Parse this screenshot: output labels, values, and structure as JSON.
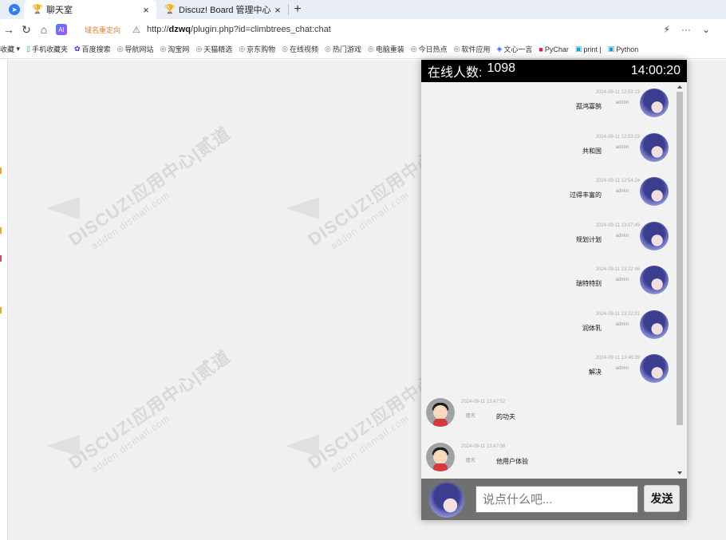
{
  "browser": {
    "tabs": [
      {
        "label": "聊天室",
        "active": true
      },
      {
        "label": "Discuz! Board 管理中心",
        "active": false
      }
    ],
    "redirect_label": "域名重定向",
    "url_prefix": "http://",
    "url_host": "dzwq",
    "url_path": "/plugin.php?id=climbtrees_chat:chat",
    "bookmarks": [
      "收藏",
      "手机收藏夹",
      "百度搜索",
      "导航网站",
      "淘宝网",
      "天猫精选",
      "京东购物",
      "在线视频",
      "热门游戏",
      "电脑重装",
      "今日热点",
      "软件应用",
      "文心一言",
      "PyChar",
      "print |",
      "Python"
    ]
  },
  "chat": {
    "online_label": "在线人数:",
    "online_count": "1098",
    "clock": "14:00:20",
    "messages": [
      {
        "side": "mine",
        "time": "2024-09-11 12:53:13",
        "user": "admin",
        "text": "孤鸿寡鹄"
      },
      {
        "side": "mine",
        "time": "2024-09-11 12:53:23",
        "user": "admin",
        "text": "共和国"
      },
      {
        "side": "mine",
        "time": "2024-09-11 12:54:24",
        "user": "admin",
        "text": "过得丰富的"
      },
      {
        "side": "mine",
        "time": "2024-09-11 13:07:49",
        "user": "admin",
        "text": "规划计划"
      },
      {
        "side": "mine",
        "time": "2024-09-11 13:22:46",
        "user": "admin",
        "text": "瑞特特别"
      },
      {
        "side": "mine",
        "time": "2024-09-11 13:22:51",
        "user": "admin",
        "text": "润体乳"
      },
      {
        "side": "mine",
        "time": "2024-09-11 13:46:39",
        "user": "admin",
        "text": "解决"
      },
      {
        "side": "other",
        "time": "2024-09-11 13:47:52",
        "user": "匿名",
        "text": "的功夫"
      },
      {
        "side": "other",
        "time": "2024-09-11 13:47:56",
        "user": "匿名",
        "text": "他用户体验"
      }
    ],
    "input_placeholder": "说点什么吧...",
    "send_label": "发送"
  },
  "watermark": {
    "main": "DISCUZ!应用中心|贰道",
    "sub": "addon.dismall.com"
  },
  "colors": {
    "header_bg": "#000000",
    "input_bar_bg": "#707070",
    "redirect_text": "#ef7a21",
    "page_bg": "#f0f0f0"
  }
}
